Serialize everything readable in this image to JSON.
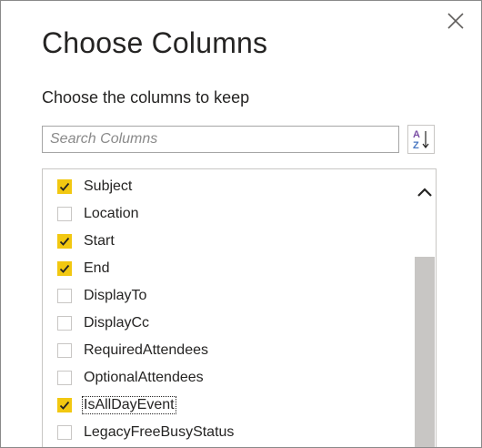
{
  "dialog": {
    "title": "Choose Columns",
    "subtitle": "Choose the columns to keep",
    "close_icon": "close-icon"
  },
  "search": {
    "placeholder": "Search Columns",
    "value": ""
  },
  "sort_button": {
    "icon": "sort-az-icon",
    "text_a": "A",
    "text_z": "Z"
  },
  "columns": [
    {
      "label": "Subject",
      "checked": true
    },
    {
      "label": "Location",
      "checked": false
    },
    {
      "label": "Start",
      "checked": true
    },
    {
      "label": "End",
      "checked": true
    },
    {
      "label": "DisplayTo",
      "checked": false
    },
    {
      "label": "DisplayCc",
      "checked": false
    },
    {
      "label": "RequiredAttendees",
      "checked": false
    },
    {
      "label": "OptionalAttendees",
      "checked": false
    },
    {
      "label": "IsAllDayEvent",
      "checked": true,
      "focused": true
    },
    {
      "label": "LegacyFreeBusyStatus",
      "checked": false
    }
  ],
  "colors": {
    "checkbox_checked": "#f2c811",
    "scroll_thumb": "#c8c6c4",
    "text": "#252423",
    "sort_icon_a": "#7b4fa5",
    "sort_icon_z": "#4a78c2"
  }
}
